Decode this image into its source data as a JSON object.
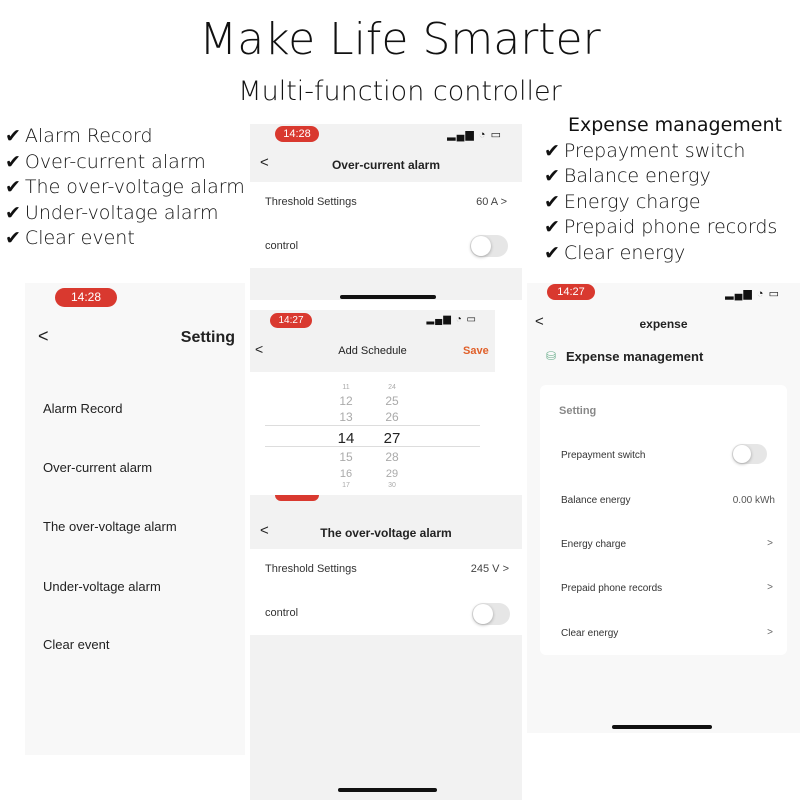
{
  "header": {
    "title": "Make Life Smarter",
    "subtitle": "Multi-function controller"
  },
  "left_features": [
    "Alarm Record",
    "Over-current alarm",
    "The over-voltage alarm",
    "Under-voltage alarm",
    "Clear event"
  ],
  "right_features": {
    "heading": "Expense management",
    "items": [
      "Prepayment switch",
      "Balance energy",
      "Energy charge",
      "Prepaid phone records",
      "Clear energy"
    ]
  },
  "check_glyph": "✔",
  "setting_screen": {
    "time": "14:28",
    "title": "Setting",
    "back": "<",
    "items": [
      "Alarm Record",
      "Over-current alarm",
      "The over-voltage alarm",
      "Under-voltage alarm",
      "Clear event"
    ]
  },
  "overcurrent_screen": {
    "time": "14:28",
    "title": "Over-current alarm",
    "back": "<",
    "threshold_label": "Threshold Settings",
    "threshold_value": "60 A >",
    "control_label": "control",
    "control_on": false
  },
  "schedule_screen": {
    "time": "14:27",
    "title": "Add Schedule",
    "back": "<",
    "save": "Save",
    "save_color": "#e0602a",
    "hours": [
      "11",
      "12",
      "13",
      "14",
      "15",
      "16",
      "17"
    ],
    "minutes": [
      "24",
      "25",
      "26",
      "27",
      "28",
      "29",
      "30"
    ],
    "selected_hour": "14",
    "selected_minute": "27"
  },
  "overvoltage_screen": {
    "title": "The over-voltage alarm",
    "back": "<",
    "threshold_label": "Threshold Settings",
    "threshold_value": "245 V >",
    "control_label": "control",
    "control_on": false
  },
  "expense_screen": {
    "time": "14:27",
    "title": "expense",
    "back": "<",
    "section": "Expense management",
    "card_title": "Setting",
    "rows": [
      {
        "label": "Prepayment switch",
        "type": "toggle",
        "on": false
      },
      {
        "label": "Balance energy",
        "value": "0.00 kWh"
      },
      {
        "label": "Energy charge",
        "value": ">"
      },
      {
        "label": "Prepaid phone records",
        "value": ">"
      },
      {
        "label": "Clear energy",
        "value": ">"
      }
    ]
  },
  "status_icons": "signal wifi battery",
  "accent": "#d9392f"
}
